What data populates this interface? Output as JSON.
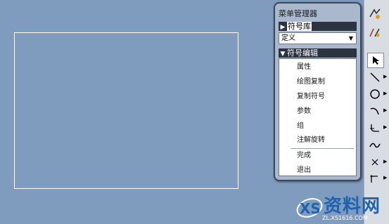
{
  "menu_manager": {
    "title": "菜单管理器",
    "symbol_library_header": "符号库",
    "definition_select_value": "定义",
    "symbol_edit_header": "符号编辑",
    "items": [
      "属性",
      "绘图复制",
      "复制符号",
      "参数",
      "组",
      "注解旋转"
    ],
    "done_label": "完成",
    "exit_label": "退出"
  },
  "watermark": {
    "text": "资料网",
    "url": "ZL.XS1616.COM"
  },
  "toolbar": {
    "tools": [
      "select-arrow-icon",
      "line-icon",
      "circle-icon",
      "arc-icon",
      "fillet-icon",
      "spline-icon",
      "point-icon",
      "coordinate-icon"
    ]
  }
}
